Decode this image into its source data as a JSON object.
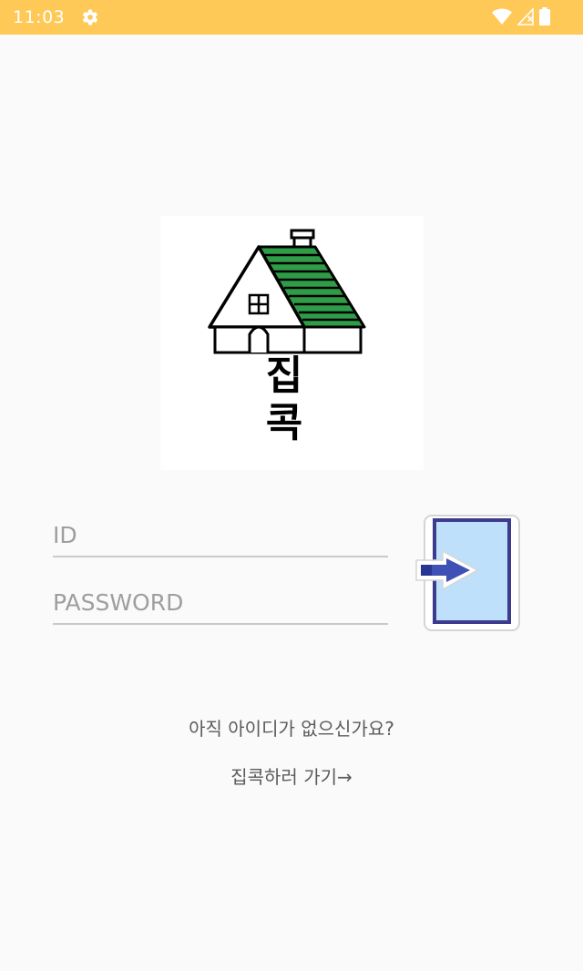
{
  "status_bar": {
    "time": "11:03",
    "icons": [
      "gear-icon",
      "wifi-icon",
      "signal-icon",
      "battery-icon"
    ],
    "background": "#ffc957"
  },
  "logo": {
    "wordmark_line1": "집",
    "wordmark_line2": "콕",
    "roof_color": "#2f9c47"
  },
  "login_form": {
    "id_placeholder": "ID",
    "id_value": "",
    "password_placeholder": "PASSWORD",
    "password_value": "",
    "login_icon": "login-door-arrow-icon",
    "login_icon_fill": "#bfe0fb",
    "login_icon_border": "#3d3b8e",
    "login_arrow_color": "#3f51b5"
  },
  "signup": {
    "question": "아직 아이디가 없으신가요?",
    "link_text": "집콕하러 가기→"
  }
}
